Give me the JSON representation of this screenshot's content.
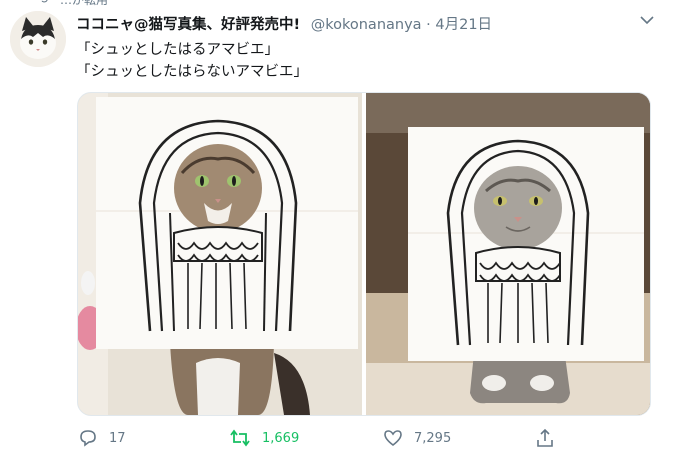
{
  "tweet": {
    "retweet_note": "…が転用",
    "author_name": "ココニャ@猫写真集、好評発売中!",
    "handle": "@kokonananya",
    "separator": "·",
    "date": "4月21日",
    "text_lines": [
      "「シュッとしたはるアマビエ」",
      "「シュッとしたはらないアマビエ」"
    ],
    "media": {
      "photos": [
        {
          "icon": "cat-amabie-photo-1"
        },
        {
          "icon": "cat-amabie-photo-2"
        }
      ]
    },
    "actions": {
      "reply_count": "17",
      "retweet_count": "1,669",
      "like_count": "7,295"
    }
  },
  "colors": {
    "text_secondary": "#657786",
    "retweet_green": "#17bf63",
    "name_text": "#14171a"
  }
}
